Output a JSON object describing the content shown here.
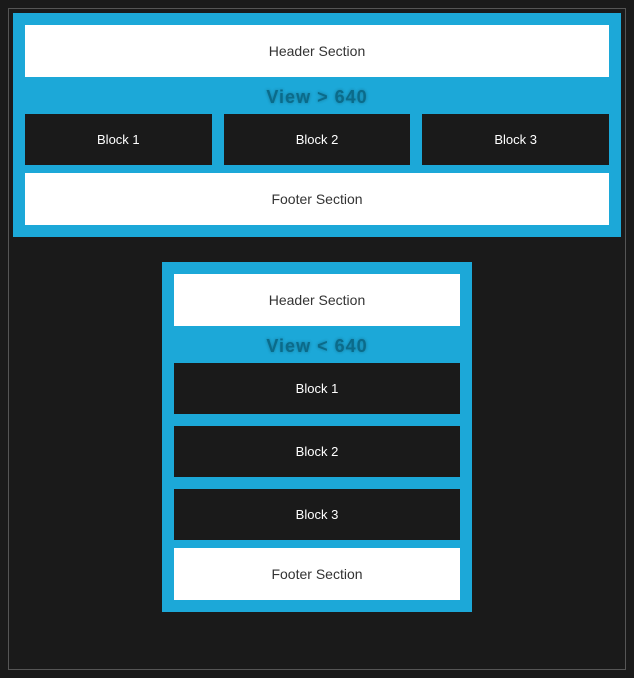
{
  "wide": {
    "header": "Header Section",
    "viewLabel": "View > 640",
    "blocks": [
      "Block 1",
      "Block 2",
      "Block 3"
    ],
    "footer": "Footer Section"
  },
  "narrow": {
    "header": "Header Section",
    "viewLabel": "View < 640",
    "blocks": [
      "Block 1",
      "Block 2",
      "Block 3"
    ],
    "footer": "Footer Section"
  }
}
